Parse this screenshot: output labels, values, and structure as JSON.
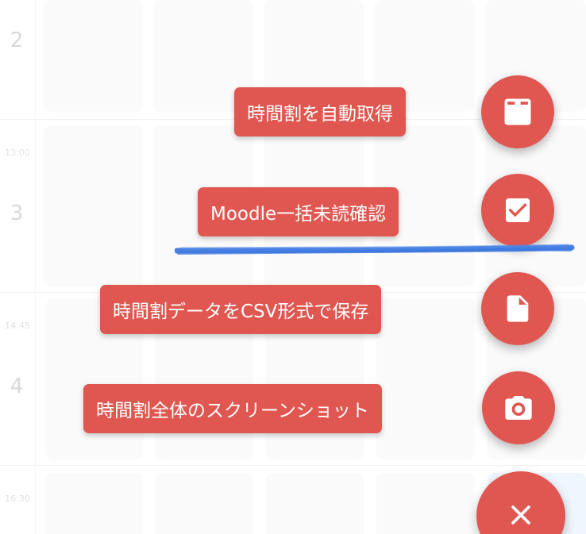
{
  "timetable": {
    "periods": [
      {
        "number": "2",
        "start_time": ""
      },
      {
        "number": "3",
        "start_time": "13:00"
      },
      {
        "number": "4",
        "start_time": "14:45"
      },
      {
        "number": "",
        "start_time": "16:30"
      }
    ]
  },
  "speed_dial": {
    "actions": [
      {
        "label": "時間割を自動取得",
        "icon": "download-icon"
      },
      {
        "label": "Moodle一括未読確認",
        "icon": "checkbox-icon"
      },
      {
        "label": "時間割データをCSV形式で保存",
        "icon": "file-icon"
      },
      {
        "label": "時間割全体のスクリーンショット",
        "icon": "camera-icon"
      }
    ],
    "close_icon": "close-icon"
  },
  "colors": {
    "accent": "#df5750",
    "annotation": "#3d78e0",
    "cell": "#f7f7f7",
    "cell_highlight": "#e8f1fd"
  }
}
